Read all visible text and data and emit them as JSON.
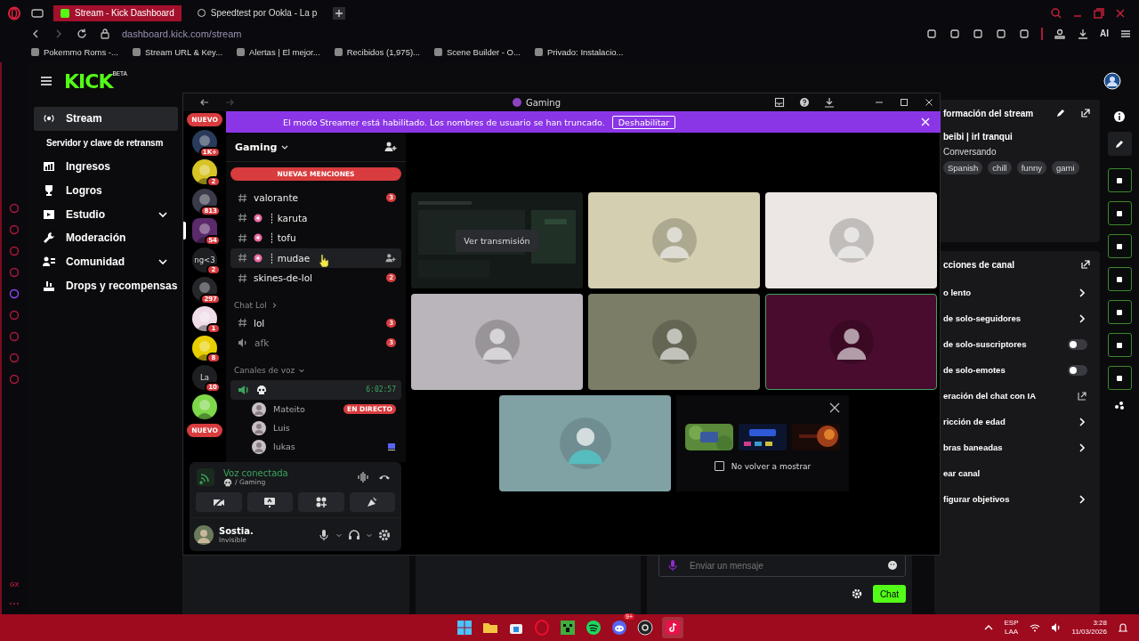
{
  "browser": {
    "tabs": [
      {
        "label": "Stream - Kick Dashboard",
        "selected": true
      },
      {
        "label": "Speedtest por Ookla - La p",
        "selected": false
      }
    ],
    "url": "dashboard.kick.com/stream",
    "bookmarks": [
      "Pokemmo Roms -...",
      "Stream URL & Key...",
      "Alertas | El mejor...",
      "Recibidos (1,975)...",
      "Scene Builder - O...",
      "Privado: Instalacio..."
    ],
    "ai_label": "AI"
  },
  "opera_sidebar": {
    "label": "GX"
  },
  "kick": {
    "logo": "KICK",
    "logo_badge": "BETA",
    "nav": [
      {
        "label": "Stream",
        "kind": "link",
        "selected": true
      },
      {
        "label": "Servidor y clave de retransm",
        "kind": "sub",
        "selected": false
      },
      {
        "label": "Ingresos",
        "kind": "link",
        "selected": false
      },
      {
        "label": "Logros",
        "kind": "link",
        "selected": false
      },
      {
        "label": "Estudio",
        "kind": "group",
        "expanded": false,
        "selected": false
      },
      {
        "label": "Moderación",
        "kind": "link",
        "selected": false
      },
      {
        "label": "Comunidad",
        "kind": "group",
        "expanded": false,
        "selected": false
      },
      {
        "label": "Drops y recompensas",
        "kind": "link",
        "selected": false
      }
    ],
    "stream_info": {
      "title": "formación del stream",
      "stream_title": "beibi | irl tranqui",
      "category": "Conversando",
      "tags": [
        "Spanish",
        "chill",
        "funny",
        "gami"
      ]
    },
    "channel_actions": {
      "title": "cciones de canal",
      "items": [
        {
          "label": "o lento",
          "kind": "link"
        },
        {
          "label": "de solo-seguidores",
          "kind": "link"
        },
        {
          "label": "de solo-suscriptores",
          "kind": "toggle",
          "on": false
        },
        {
          "label": "de solo-emotes",
          "kind": "toggle",
          "on": false
        },
        {
          "label": "eración del chat con IA",
          "kind": "external"
        },
        {
          "label": "ricción de edad",
          "kind": "link"
        },
        {
          "label": "bras baneadas",
          "kind": "link"
        },
        {
          "label": "ear canal",
          "kind": "plain"
        },
        {
          "label": "figurar objetivos",
          "kind": "link"
        }
      ]
    },
    "chat": {
      "placeholder": "Enviar un mensaje",
      "send": "Chat"
    }
  },
  "discord": {
    "title": "Gaming",
    "banner": {
      "text": "El modo Streamer está habilitado. Los nombres de usuario se han truncado.",
      "button": "Deshabilitar"
    },
    "servers": [
      {
        "kind": "new",
        "badge": "NUEVO"
      },
      {
        "kind": "server",
        "badge": "1K+",
        "selected": false
      },
      {
        "kind": "server",
        "badge": "2",
        "selected": false
      },
      {
        "kind": "server",
        "badge": "813",
        "selected": false
      },
      {
        "kind": "server",
        "badge": "54",
        "selected": true
      },
      {
        "kind": "server",
        "label": "ng<3",
        "badge": "2",
        "selected": false
      },
      {
        "kind": "server",
        "badge": "297",
        "selected": false
      },
      {
        "kind": "server",
        "badge": "1",
        "selected": false
      },
      {
        "kind": "server",
        "badge": "8",
        "selected": false
      },
      {
        "kind": "server",
        "label": "La",
        "badge": "10",
        "selected": false
      },
      {
        "kind": "server",
        "selected": false
      },
      {
        "kind": "new",
        "badge": "NUEVO"
      }
    ],
    "server_name": "Gaming",
    "mentions": "NUEVAS MENCIONES",
    "channels": [
      {
        "name": "valorante",
        "kind": "text",
        "badge": "3",
        "selected": false
      },
      {
        "name": "┊ karuta",
        "kind": "emoji",
        "selected": false
      },
      {
        "name": "┊ tofu",
        "kind": "emoji",
        "selected": false
      },
      {
        "name": "┊ mudae",
        "kind": "emoji",
        "selected": true
      },
      {
        "name": "skines-de-lol",
        "kind": "text",
        "badge": "2",
        "selected": false
      }
    ],
    "categories": [
      {
        "name": "Chat Lol",
        "expanded": false,
        "channels": [
          {
            "name": "lol",
            "kind": "text",
            "badge": "3",
            "selected": false
          },
          {
            "name": "afk",
            "kind": "voice",
            "badge": "3",
            "selected": false
          }
        ]
      },
      {
        "name": "Canales de voz",
        "expanded": true,
        "channels": [
          {
            "kind": "connected",
            "timer": "6:02:57",
            "selected": true,
            "members": [
              {
                "name": "Mateito",
                "live": "EN DIRECTO",
                "activity": false
              },
              {
                "name": "Luis",
                "activity": false
              },
              {
                "name": "lukas",
                "activity": true
              }
            ]
          }
        ]
      }
    ],
    "voice": {
      "status": "Voz conectada",
      "channel": "/ Gaming"
    },
    "user": {
      "name": "Sostia.",
      "status": "Invisible"
    },
    "tiles": [
      {
        "kind": "stream",
        "button": "Ver transmisión",
        "speaking": false
      },
      {
        "kind": "avatar",
        "color": "#d4cfb0",
        "speaking": false
      },
      {
        "kind": "avatar",
        "color": "#ece7e4",
        "speaking": false
      },
      {
        "kind": "avatar",
        "color": "#bab5ba",
        "speaking": false
      },
      {
        "kind": "avatar",
        "color": "#7b7d66",
        "speaking": false
      },
      {
        "kind": "avatar",
        "color": "#4a0c2e",
        "speaking": true
      },
      {
        "kind": "avatar",
        "color": "#80a2a5",
        "speaking": false
      }
    ],
    "activities": {
      "checkbox": {
        "label": "No volver a mostrar",
        "checked": false
      }
    }
  },
  "taskbar": {
    "badge": "9+",
    "lang": "ESP",
    "layout": "LAA",
    "time": "3:28",
    "date": "11/03/2026"
  }
}
